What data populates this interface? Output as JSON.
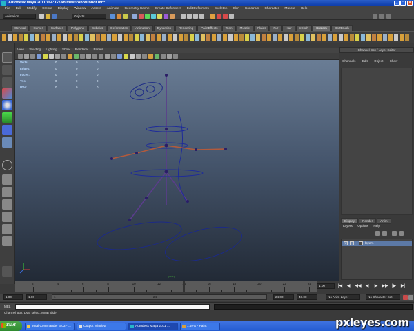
{
  "window": {
    "title": "Autodesk Maya 2011 x64: G:\\Animest\\robot\\robot.mb*"
  },
  "menubar": [
    "File",
    "Edit",
    "Modify",
    "Create",
    "Display",
    "Window",
    "Assets",
    "Animate",
    "Geometry Cache",
    "Create Deformers",
    "Edit Deformers",
    "Skeleton",
    "Skin",
    "Constrain",
    "Character",
    "Muscle",
    "Help"
  ],
  "statusline": {
    "menuset": "Animation",
    "selection_mask": "Objects"
  },
  "shelf": {
    "tabs": [
      "General",
      "Curves",
      "Surfaces",
      "Polygons",
      "Subdivs",
      "Deformation",
      "Animation",
      "Dynamics",
      "Rendering",
      "PaintEffects",
      "Toon",
      "Muscle",
      "Fluids",
      "Fur",
      "Hair",
      "nCloth",
      "Custom",
      "GoZBrush"
    ],
    "active_tab": "Custom"
  },
  "viewport": {
    "menu": [
      "View",
      "Shading",
      "Lighting",
      "Show",
      "Renderer",
      "Panels"
    ],
    "hud": [
      {
        "label": "Verts:",
        "values": [
          "0",
          "0",
          "0"
        ]
      },
      {
        "label": "Edges:",
        "values": [
          "0",
          "0",
          "0"
        ]
      },
      {
        "label": "Faces:",
        "values": [
          "0",
          "0",
          "0"
        ]
      },
      {
        "label": "Tris:",
        "values": [
          "0",
          "0",
          "0"
        ]
      },
      {
        "label": "UVs:",
        "values": [
          "0",
          "0",
          "0"
        ]
      }
    ],
    "camera": "persp"
  },
  "channelbox": {
    "title": "Channel Box / Layer Editor",
    "menu": [
      "Channels",
      "Edit",
      "Object",
      "Show"
    ]
  },
  "layers": {
    "tabs": [
      "Display",
      "Render",
      "Anim"
    ],
    "active_tab": "Display",
    "menu": [
      "Layers",
      "Options",
      "Help"
    ],
    "items": [
      {
        "v": "V",
        "name": "layer1"
      }
    ]
  },
  "timeslider": {
    "ticks": [
      "2",
      "4",
      "6",
      "8",
      "10",
      "12",
      "14",
      "16",
      "18",
      "20",
      "22",
      "24"
    ],
    "current_frame_marker": "14",
    "current_frame": "1.00"
  },
  "playback": [
    "|◀",
    "◀|",
    "◀◀",
    "◀",
    "▶",
    "▶▶",
    "|▶",
    "▶|"
  ],
  "range": {
    "start": "1.00",
    "playback_start": "1.00",
    "slider_min": "1",
    "slider_max": "24",
    "playback_end": "24.00",
    "end": "48.00",
    "anim_layer": "No Anim Layer",
    "character_set": "No Character Set"
  },
  "commandline": {
    "label": "MEL"
  },
  "helpline": {
    "text": "Channel Box: LMB select, MMB slide"
  },
  "taskbar": {
    "start": "Start",
    "buttons": [
      {
        "label": "Total Commander 6.03 - ..."
      },
      {
        "label": "Output Window"
      },
      {
        "label": "Autodesk Maya 2011 ..."
      },
      {
        "label": "1.JPG - Paint"
      }
    ]
  },
  "watermark": "pxleyes.com"
}
